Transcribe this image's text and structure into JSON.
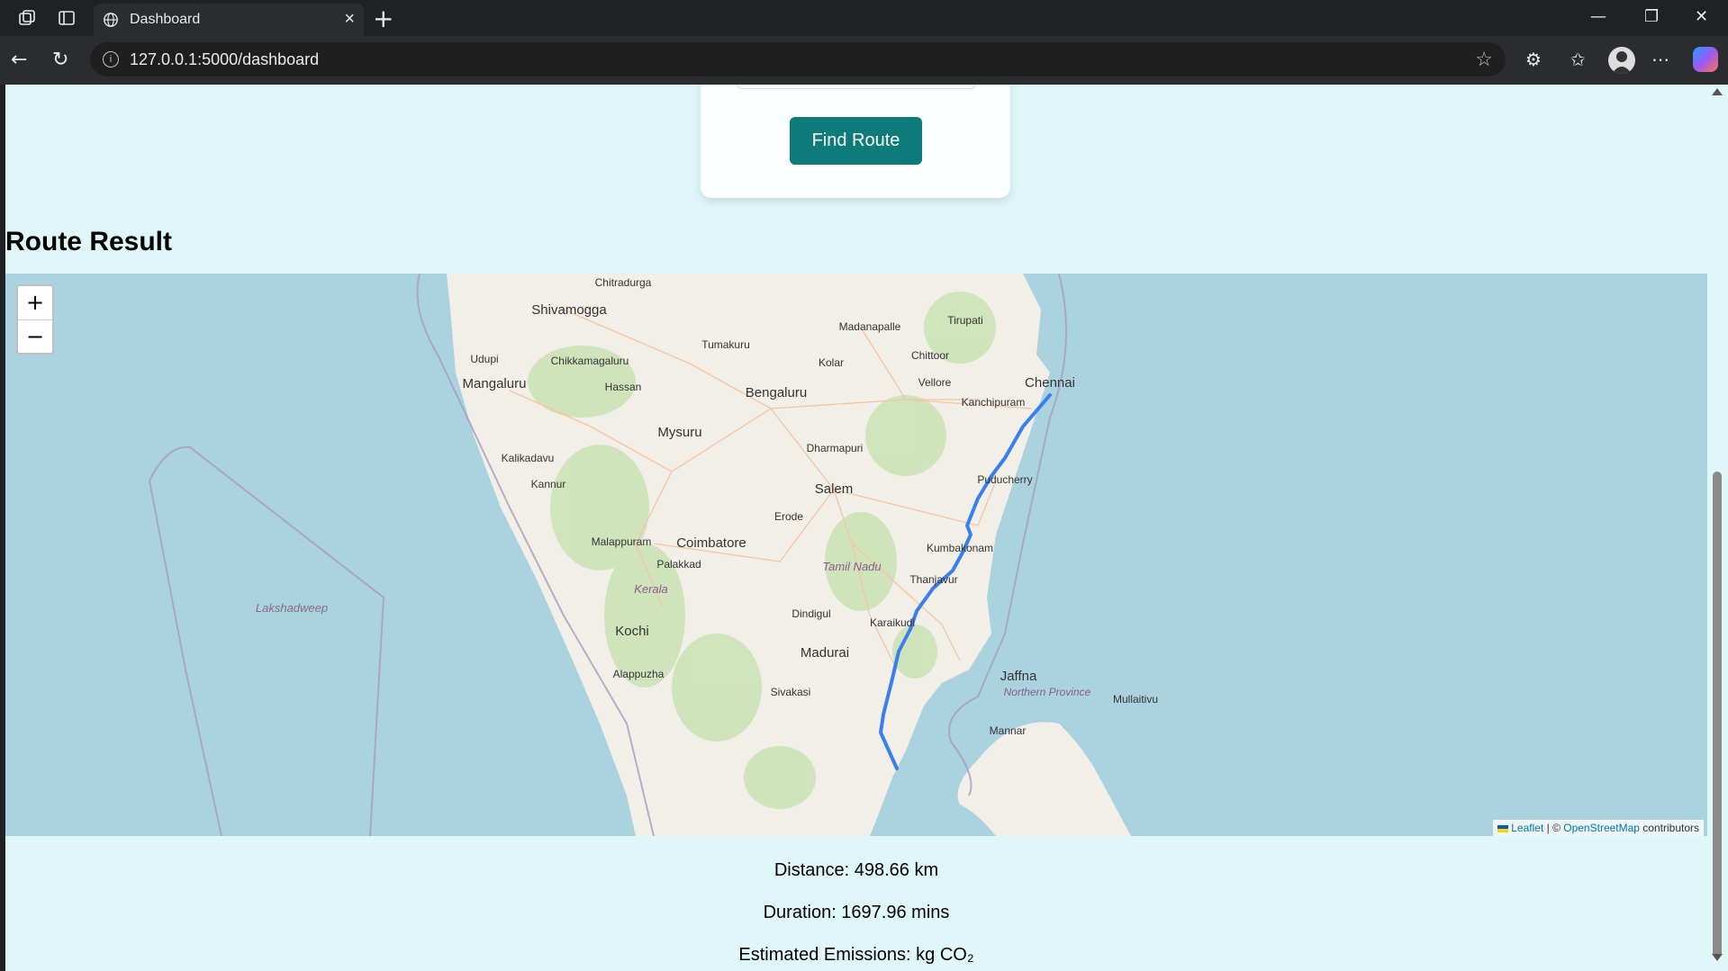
{
  "browser": {
    "tab_title": "Dashboard",
    "url": "127.0.0.1:5000/dashboard"
  },
  "page": {
    "find_button": "Find Route",
    "result_heading": "Route Result",
    "distance": "Distance: 498.66 km",
    "duration": "Duration: 1697.96 mins",
    "emissions": "Estimated Emissions: kg CO₂"
  },
  "map": {
    "zoom_in": "+",
    "zoom_out": "−",
    "attribution_link1": "Leaflet",
    "attribution_sep": " | © ",
    "attribution_link2": "OpenStreetMap",
    "attribution_tail": " contributors",
    "places": [
      "Chitradurga",
      "Shivamogga",
      "Madanapalle",
      "Tirupati",
      "Tumakuru",
      "Udupi",
      "Chikkamagaluru",
      "Chittoor",
      "Kolar",
      "Mangaluru",
      "Hassan",
      "Bengaluru",
      "Vellore",
      "Chennai",
      "Kanchipuram",
      "Mysuru",
      "Dharmapuri",
      "Kalikadavu",
      "Kannur",
      "Salem",
      "Puducherry",
      "Erode",
      "Malappuram",
      "Coimbatore",
      "Kumbakonam",
      "Palakkad",
      "Tamil Nadu",
      "Thanjavur",
      "Kerala",
      "Lakshadweep",
      "Dindigul",
      "Karaikudi",
      "Kochi",
      "Madurai",
      "Jaffna",
      "Alappuzha",
      "Northern Province",
      "Mullaitivu",
      "Sivakasi",
      "Mannar"
    ]
  },
  "colors": {
    "page_bg": "#e0f7f9",
    "button_bg": "#0d7b79",
    "route": "#3a7ff0",
    "sea": "#aad3df",
    "land": "#f2efe9"
  }
}
